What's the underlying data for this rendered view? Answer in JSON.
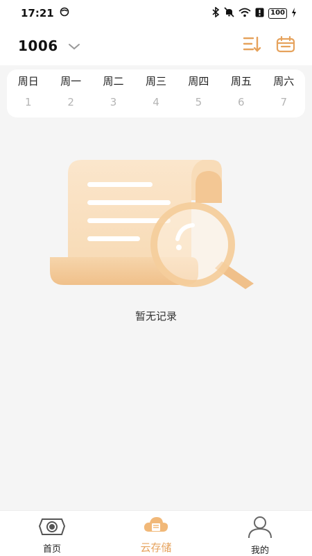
{
  "status_bar": {
    "time": "17:21",
    "battery": "100",
    "icons": [
      "face-icon",
      "bluetooth-icon",
      "mute-icon",
      "wifi-icon",
      "alert-icon",
      "battery-icon",
      "charging-icon"
    ]
  },
  "header": {
    "device": "1006",
    "icons": [
      "chevron-down-icon",
      "sort-icon",
      "calendar-icon"
    ]
  },
  "week": {
    "days": [
      {
        "name": "周日",
        "num": "1"
      },
      {
        "name": "周一",
        "num": "2"
      },
      {
        "name": "周二",
        "num": "3"
      },
      {
        "name": "周三",
        "num": "4"
      },
      {
        "name": "周四",
        "num": "5"
      },
      {
        "name": "周五",
        "num": "6"
      },
      {
        "name": "周六",
        "num": "7"
      }
    ]
  },
  "empty_state": {
    "text": "暂无记录",
    "icon": "empty-records-illustration"
  },
  "tabbar": {
    "tabs": [
      {
        "label": "首页",
        "icon": "camera-eye-icon"
      },
      {
        "label": "云存储",
        "icon": "cloud-storage-icon"
      },
      {
        "label": "我的",
        "icon": "user-icon"
      }
    ],
    "active": "云存储"
  },
  "colors": {
    "accent": "#e6a25c",
    "illustration_light": "#f8ddb9",
    "background": "#f5f5f5"
  }
}
